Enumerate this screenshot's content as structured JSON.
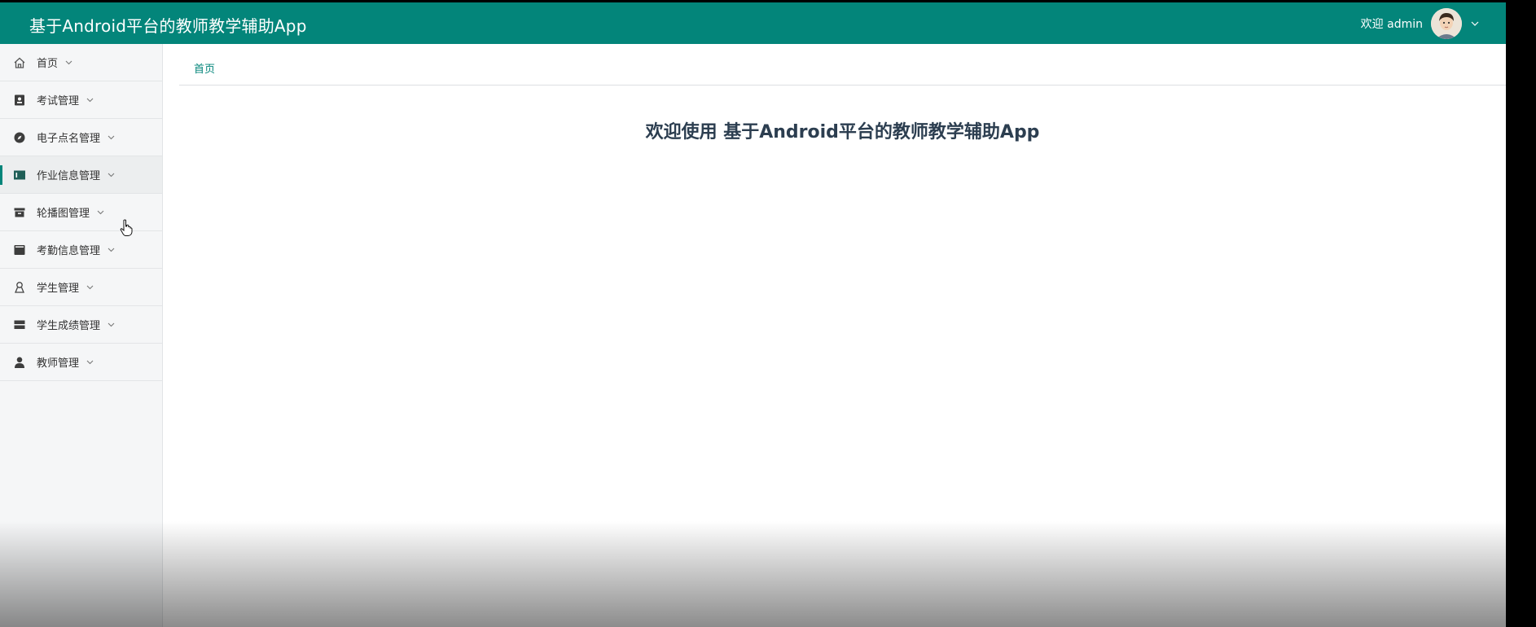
{
  "header": {
    "app_title": "基于Android平台的教师教学辅助App",
    "welcome_text": "欢迎 admin",
    "brand_color": "#03857a"
  },
  "sidebar": {
    "items": [
      {
        "label": "首页",
        "icon": "home-icon"
      },
      {
        "label": "考试管理",
        "icon": "exam-icon"
      },
      {
        "label": "电子点名管理",
        "icon": "compass-icon"
      },
      {
        "label": "作业信息管理",
        "icon": "homework-icon",
        "active": true
      },
      {
        "label": "轮播图管理",
        "icon": "archive-icon"
      },
      {
        "label": "考勤信息管理",
        "icon": "attendance-icon"
      },
      {
        "label": "学生管理",
        "icon": "student-icon"
      },
      {
        "label": "学生成绩管理",
        "icon": "grades-icon"
      },
      {
        "label": "教师管理",
        "icon": "teacher-icon"
      }
    ]
  },
  "main": {
    "breadcrumb": "首页",
    "heading": "欢迎使用 基于Android平台的教师教学辅助App"
  }
}
